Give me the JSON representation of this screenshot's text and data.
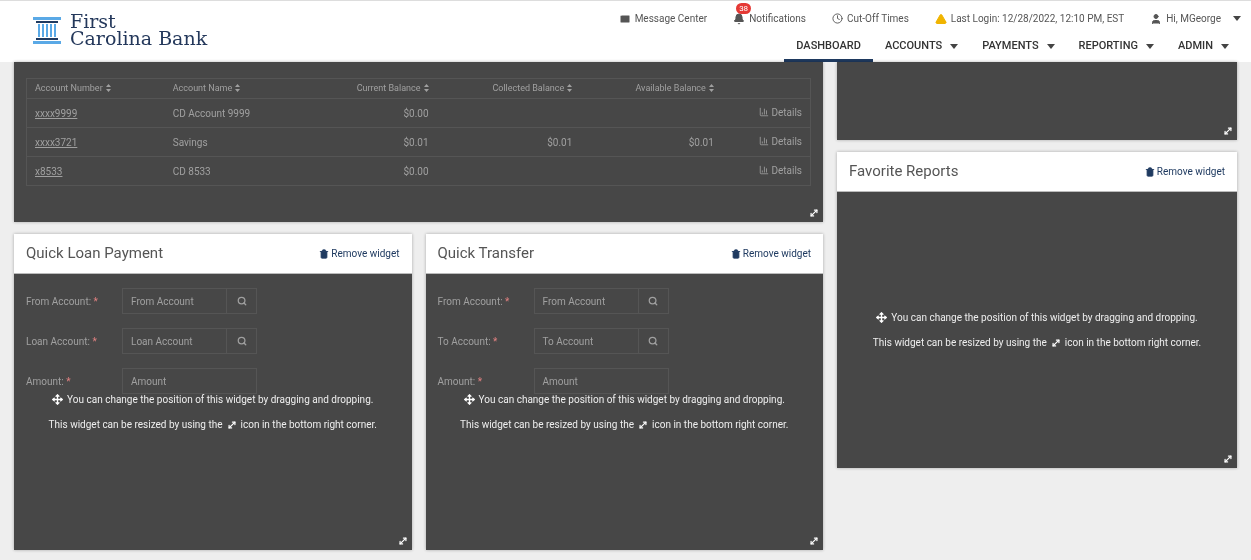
{
  "header": {
    "logo": {
      "line1": "First",
      "line2": "Carolina Bank"
    },
    "top_links": [
      {
        "kind": "message",
        "label": "Message Center"
      },
      {
        "kind": "notifications",
        "label": "Notifications",
        "badge": "38"
      },
      {
        "kind": "clock",
        "label": "Cut-Off Times"
      },
      {
        "kind": "warning",
        "label": "Last Login: 12/28/2022, 12:10 PM, EST"
      },
      {
        "kind": "user",
        "label": "Hi, MGeorge",
        "dropdown": true
      }
    ],
    "nav": [
      {
        "label": "DASHBOARD",
        "selected": true,
        "dropdown": false
      },
      {
        "label": "ACCOUNTS",
        "selected": false,
        "dropdown": true
      },
      {
        "label": "PAYMENTS",
        "selected": false,
        "dropdown": true
      },
      {
        "label": "REPORTING",
        "selected": false,
        "dropdown": true
      },
      {
        "label": "ADMIN",
        "selected": false,
        "dropdown": true
      }
    ]
  },
  "accounts_widget": {
    "columns": [
      {
        "label": "Account Number"
      },
      {
        "label": "Account Name"
      },
      {
        "label": "Current Balance"
      },
      {
        "label": "Collected Balance"
      },
      {
        "label": "Available Balance"
      }
    ],
    "rows": [
      {
        "cells": [
          "xxxx9999",
          "CD Account 9999",
          "$0.00",
          "",
          ""
        ],
        "action": "Details"
      },
      {
        "cells": [
          "xxxx3721",
          "Savings",
          "$0.01",
          "$0.01",
          "$0.01"
        ],
        "action": "Details"
      },
      {
        "cells": [
          "x8533",
          "CD 8533",
          "$0.00",
          "",
          ""
        ],
        "action": "Details"
      }
    ]
  },
  "widgets": [
    {
      "title": "Quick Loan Payment",
      "remove": "Remove widget",
      "fields": [
        {
          "kind": "lookup",
          "label": "From Account:",
          "marker": "*",
          "placeholder": "From Account"
        },
        {
          "kind": "lookup",
          "label": "Loan Account:",
          "marker": "*",
          "placeholder": "Loan Account"
        },
        {
          "kind": "text",
          "label": "Amount:",
          "marker": "*",
          "placeholder": "Amount"
        }
      ],
      "overlay": {
        "line1": "You can change the position of this widget by dragging and dropping.",
        "line2a": "This widget can be resized by using the",
        "line2b": "icon in the bottom right corner."
      }
    },
    {
      "title": "Quick Transfer",
      "remove": "Remove widget",
      "fields": [
        {
          "kind": "lookup",
          "label": "From Account:",
          "marker": "*",
          "placeholder": "From Account"
        },
        {
          "kind": "lookup",
          "label": "To Account:",
          "marker": "*",
          "placeholder": "To Account"
        },
        {
          "kind": "text",
          "label": "Amount:",
          "marker": "*",
          "placeholder": "Amount"
        }
      ],
      "overlay": {
        "line1": "You can change the position of this widget by dragging and dropping.",
        "line2a": "This widget can be resized by using the",
        "line2b": "icon in the bottom right corner."
      }
    }
  ],
  "favorite_reports": {
    "title": "Favorite Reports",
    "remove": "Remove widget",
    "overlay": {
      "line1": "You can change the position of this widget by dragging and dropping.",
      "line2a": "This widget can be resized by using the",
      "line2b": "icon in the bottom right corner."
    }
  }
}
